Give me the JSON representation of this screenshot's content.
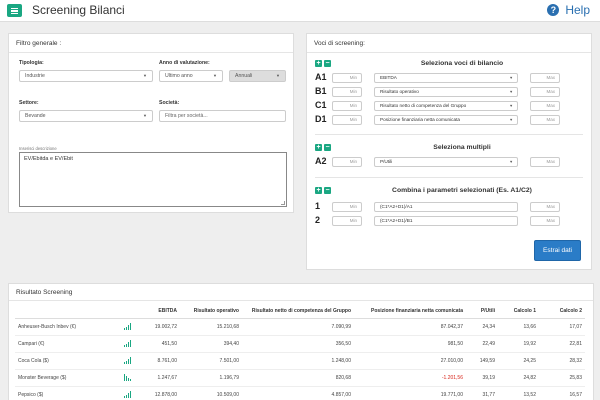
{
  "app": {
    "title": "Screening Bilanci",
    "help_label": "Help"
  },
  "filters": {
    "title": "Filtro generale :",
    "tipologia": {
      "label": "Tipologia:",
      "value": "Industrie"
    },
    "anno": {
      "label": "Anno di valutazione:",
      "value": "Ultimo anno",
      "period": "Annuali"
    },
    "settore": {
      "label": "Settore:",
      "value": "Bevande"
    },
    "societa": {
      "label": "Società:",
      "placeholder": "Filtra per società..."
    },
    "description": {
      "label": "Inserisci descrizione",
      "value": "EV/Ebitda e EV/Ebit"
    }
  },
  "screening": {
    "title": "Voci di screening:",
    "bilancio": {
      "title": "Seleziona voci di bilancio",
      "rows": [
        {
          "code": "A1",
          "min": "Min",
          "item": "EBITDA",
          "max": "Max"
        },
        {
          "code": "B1",
          "min": "Min",
          "item": "Risultato operativo",
          "max": "Max"
        },
        {
          "code": "C1",
          "min": "Min",
          "item": "Risultato netto di competenza del Gruppo",
          "max": "Max"
        },
        {
          "code": "D1",
          "min": "Min",
          "item": "Posizione finanziaria netta comunicata",
          "max": "Max"
        }
      ]
    },
    "multipli": {
      "title": "Seleziona multipli",
      "rows": [
        {
          "code": "A2",
          "min": "Min",
          "item": "P/Utili",
          "max": "Max"
        }
      ]
    },
    "combina": {
      "title": "Combina i parametri selezionati (Es. A1/C2)",
      "rows": [
        {
          "code": "1",
          "min": "Min",
          "formula": "(C1*A2+D1)/A1",
          "max": "Max"
        },
        {
          "code": "2",
          "min": "Min",
          "formula": "(C1*A2+D1)/B1",
          "max": "Max"
        }
      ]
    },
    "submit_label": "Estrai dati"
  },
  "results": {
    "title": "Risultato Screening",
    "columns": [
      "",
      "",
      "EBITDA",
      "Risultato operativo",
      "Risultato netto di competenza del Gruppo",
      "Posizione finanziaria netta comunicata",
      "P/Utili",
      "Calcolo 1",
      "Calcolo 2"
    ],
    "rows": [
      {
        "name": "Anheuser-Busch Inbev (€)",
        "trend": "up",
        "ebitda": "19.002,72",
        "ro": "15.210,68",
        "rn": "7.090,99",
        "pfn": "87.042,37",
        "pfn_negative": false,
        "pu": "24,34",
        "c1": "13,66",
        "c2": "17,07"
      },
      {
        "name": "Campari (€)",
        "trend": "up",
        "ebitda": "451,50",
        "ro": "394,40",
        "rn": "356,50",
        "pfn": "981,50",
        "pfn_negative": false,
        "pu": "22,49",
        "c1": "19,92",
        "c2": "22,81"
      },
      {
        "name": "Coca Cola ($)",
        "trend": "up",
        "ebitda": "8.761,00",
        "ro": "7.501,00",
        "rn": "1.248,00",
        "pfn": "27.010,00",
        "pfn_negative": false,
        "pu": "149,59",
        "c1": "24,25",
        "c2": "28,32"
      },
      {
        "name": "Monster Beverage ($)",
        "trend": "down",
        "ebitda": "1.247,67",
        "ro": "1.196,79",
        "rn": "820,68",
        "pfn": "-1.201,56",
        "pfn_negative": true,
        "pu": "39,19",
        "c1": "24,82",
        "c2": "25,83"
      },
      {
        "name": "Pepsico ($)",
        "trend": "up",
        "ebitda": "12.878,00",
        "ro": "10.509,00",
        "rn": "4.857,00",
        "pfn": "19.771,00",
        "pfn_negative": false,
        "pu": "31,77",
        "c1": "13,52",
        "c2": "16,57"
      }
    ]
  }
}
